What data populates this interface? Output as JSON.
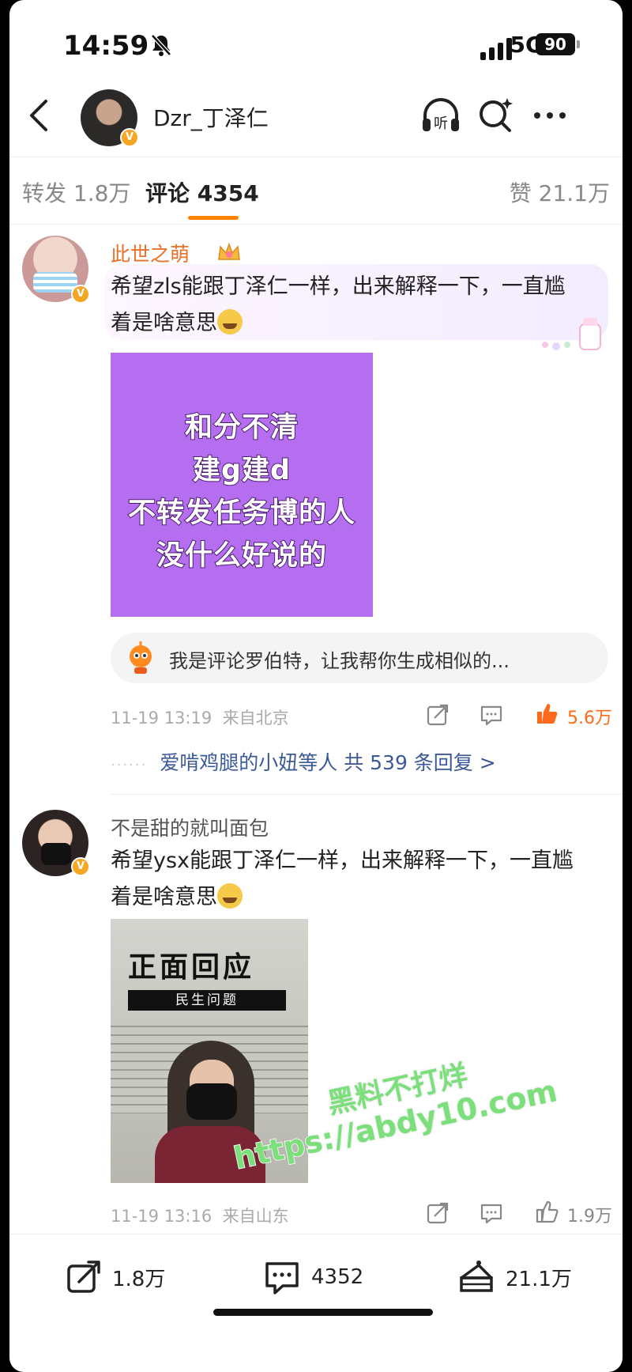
{
  "status_bar": {
    "time": "14:59",
    "network": "5G",
    "battery": "90"
  },
  "header": {
    "username": "Dzr_丁泽仁",
    "listen_label": "听"
  },
  "tabs": {
    "repost": "转发 1.8万",
    "comments": "评论 4354",
    "likes": "赞 21.1万"
  },
  "comments": [
    {
      "author": "此世之萌",
      "text": "希望zls能跟丁泽仁一样，出来解释一下，一直尴着是啥意思",
      "image_lines": [
        "和分不清",
        "建g建d",
        "不转发任务博的人",
        "没什么好说的"
      ],
      "robot_prompt": "我是评论罗伯特，让我帮你生成相似的...",
      "time": "11-19 13:19",
      "location": "来自北京",
      "like_count": "5.6万",
      "liked": true,
      "replies_text": "爱啃鸡腿的小妞等人 共 539 条回复 >"
    },
    {
      "author": "不是甜的就叫面包",
      "text": "希望ysx能跟丁泽仁一样，出来解释一下，一直尴着是啥意思",
      "image_title": "正面回应",
      "image_subtitle": "民生问题",
      "time": "11-19 13:16",
      "location": "来自山东",
      "like_count": "1.9万",
      "liked": false
    }
  ],
  "watermark": {
    "line1": "黑料不打烊",
    "line2": "https://abdy10.com"
  },
  "bottom_bar": {
    "repost": "1.8万",
    "comments": "4352",
    "likes": "21.1万"
  },
  "colors": {
    "accent": "#ff8200",
    "link": "#3b5998",
    "name_highlight": "#e8712a"
  }
}
